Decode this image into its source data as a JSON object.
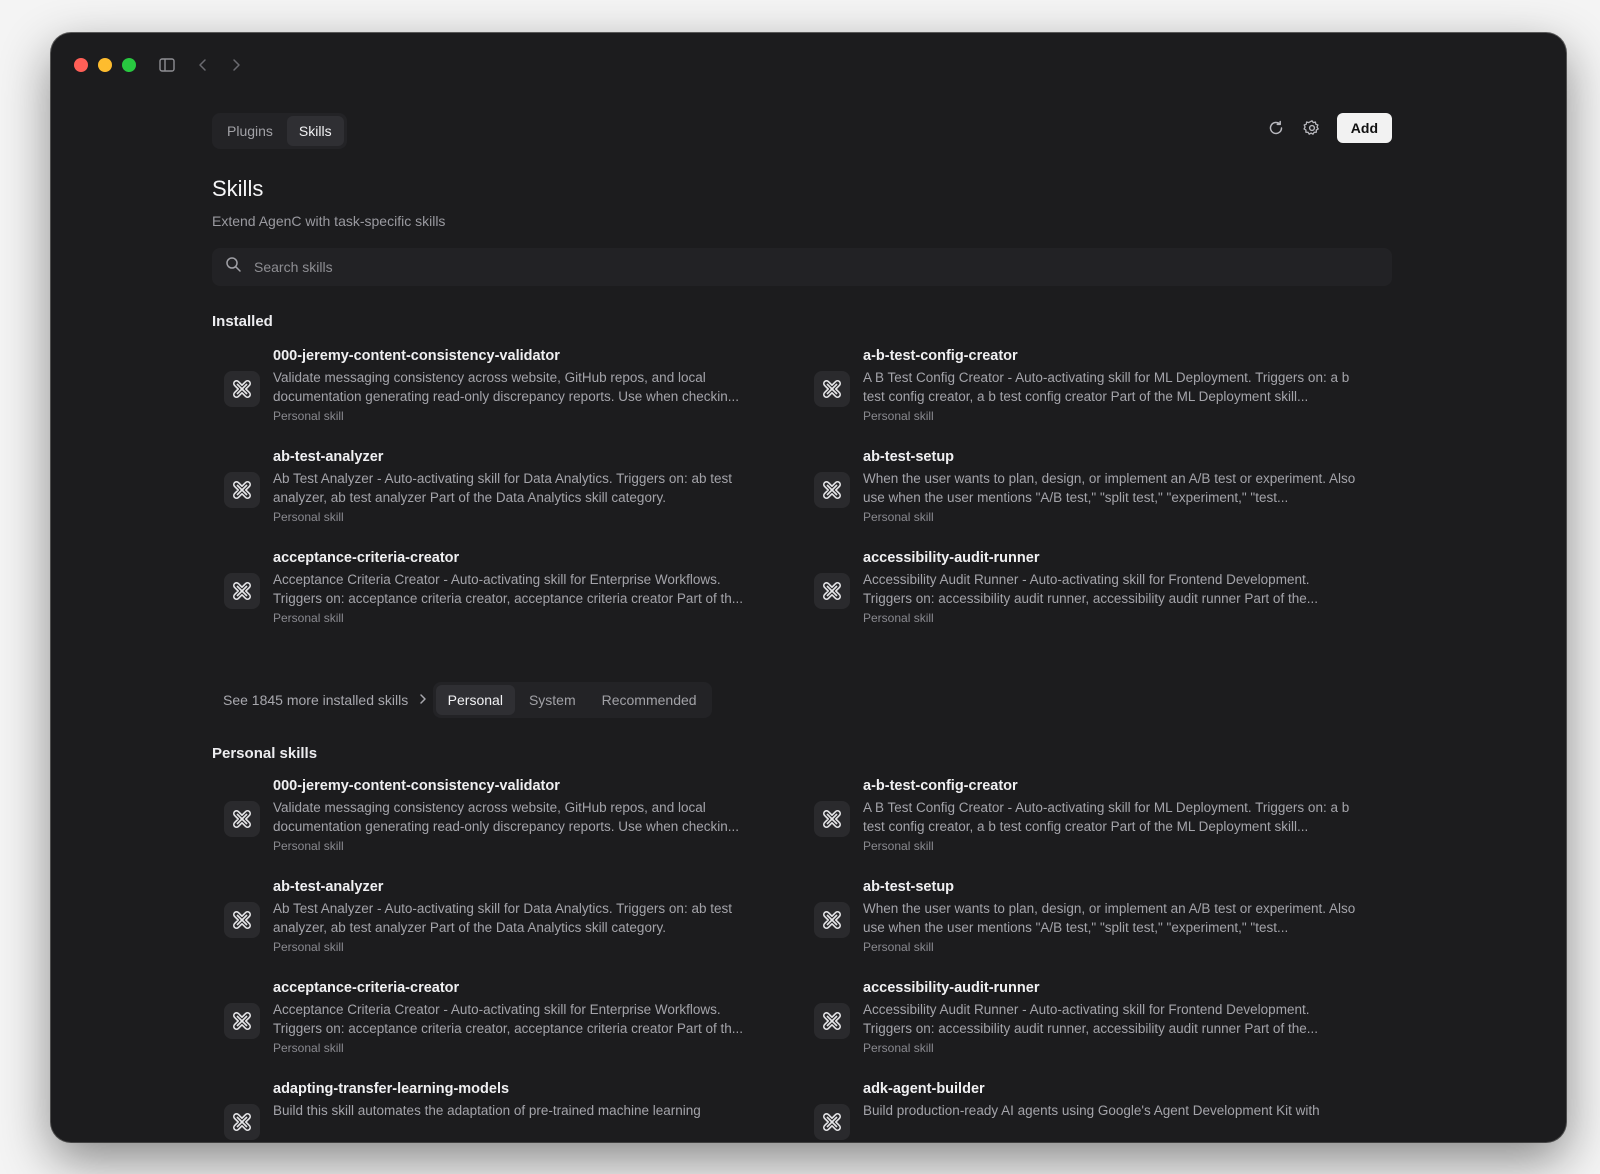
{
  "top_tabs": [
    {
      "label": "Plugins",
      "active": false
    },
    {
      "label": "Skills",
      "active": true
    }
  ],
  "actions": {
    "refresh_icon": "refresh-icon",
    "settings_icon": "gear-icon",
    "add_label": "Add"
  },
  "page": {
    "title": "Skills",
    "subtitle": "Extend AgenC with task-specific skills"
  },
  "search": {
    "placeholder": "Search skills",
    "value": ""
  },
  "installed": {
    "title": "Installed",
    "items": [
      {
        "name": "000-jeremy-content-consistency-validator",
        "description": "Validate messaging consistency across website, GitHub repos, and local documentation generating read-only discrepancy reports. Use when checkin...",
        "kind": "Personal skill"
      },
      {
        "name": "a-b-test-config-creator",
        "description": "A B Test Config Creator - Auto-activating skill for ML Deployment. Triggers on: a b test config creator, a b test config creator Part of the ML Deployment skill...",
        "kind": "Personal skill"
      },
      {
        "name": "ab-test-analyzer",
        "description": "Ab Test Analyzer - Auto-activating skill for Data Analytics. Triggers on: ab test analyzer, ab test analyzer Part of the Data Analytics skill category.",
        "kind": "Personal skill"
      },
      {
        "name": "ab-test-setup",
        "description": "When the user wants to plan, design, or implement an A/B test or experiment. Also use when the user mentions \"A/B test,\" \"split test,\" \"experiment,\" \"test...",
        "kind": "Personal skill"
      },
      {
        "name": "acceptance-criteria-creator",
        "description": "Acceptance Criteria Creator - Auto-activating skill for Enterprise Workflows. Triggers on: acceptance criteria creator, acceptance criteria creator Part of th...",
        "kind": "Personal skill"
      },
      {
        "name": "accessibility-audit-runner",
        "description": "Accessibility Audit Runner - Auto-activating skill for Frontend Development. Triggers on: accessibility audit runner, accessibility audit runner Part of the...",
        "kind": "Personal skill"
      }
    ],
    "see_more": "See 1845 more installed skills"
  },
  "filter_tabs": [
    {
      "label": "Personal",
      "active": true
    },
    {
      "label": "System",
      "active": false
    },
    {
      "label": "Recommended",
      "active": false
    }
  ],
  "personal": {
    "title": "Personal skills",
    "items": [
      {
        "name": "000-jeremy-content-consistency-validator",
        "description": "Validate messaging consistency across website, GitHub repos, and local documentation generating read-only discrepancy reports. Use when checkin...",
        "kind": "Personal skill"
      },
      {
        "name": "a-b-test-config-creator",
        "description": "A B Test Config Creator - Auto-activating skill for ML Deployment. Triggers on: a b test config creator, a b test config creator Part of the ML Deployment skill...",
        "kind": "Personal skill"
      },
      {
        "name": "ab-test-analyzer",
        "description": "Ab Test Analyzer - Auto-activating skill for Data Analytics. Triggers on: ab test analyzer, ab test analyzer Part of the Data Analytics skill category.",
        "kind": "Personal skill"
      },
      {
        "name": "ab-test-setup",
        "description": "When the user wants to plan, design, or implement an A/B test or experiment. Also use when the user mentions \"A/B test,\" \"split test,\" \"experiment,\" \"test...",
        "kind": "Personal skill"
      },
      {
        "name": "acceptance-criteria-creator",
        "description": "Acceptance Criteria Creator - Auto-activating skill for Enterprise Workflows. Triggers on: acceptance criteria creator, acceptance criteria creator Part of th...",
        "kind": "Personal skill"
      },
      {
        "name": "accessibility-audit-runner",
        "description": "Accessibility Audit Runner - Auto-activating skill for Frontend Development. Triggers on: accessibility audit runner, accessibility audit runner Part of the...",
        "kind": "Personal skill"
      },
      {
        "name": "adapting-transfer-learning-models",
        "description": "Build this skill automates the adaptation of pre-trained machine learning",
        "kind": ""
      },
      {
        "name": "adk-agent-builder",
        "description": "Build production-ready AI agents using Google's Agent Development Kit with",
        "kind": ""
      }
    ]
  },
  "colors": {
    "window_bg": "#1c1c1e",
    "accent_button": "#f2f2f2",
    "traffic_red": "#ff5f57",
    "traffic_yellow": "#febc2e",
    "traffic_green": "#28c840"
  }
}
